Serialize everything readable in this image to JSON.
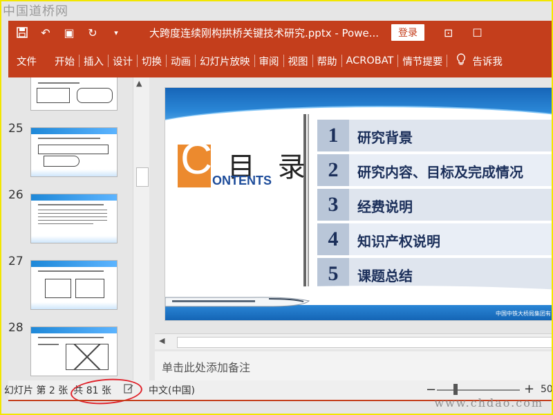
{
  "watermarks": {
    "top": "中国道桥网",
    "bottom": "www.chdao.com"
  },
  "titlebar": {
    "doc_title": "大跨度连续刚构拱桥关键技术研究.pptx - Powe...",
    "login_label": "登录",
    "icons": [
      "save-icon",
      "undo-icon",
      "present-from-start-icon",
      "redo-icon",
      "customize-qat-icon",
      "ribbon-display-icon",
      "maximize-icon"
    ]
  },
  "ribbon": {
    "tabs": [
      "文件",
      "开始",
      "插入",
      "设计",
      "切换",
      "动画",
      "幻灯片放映",
      "审阅",
      "视图",
      "帮助",
      "ACROBAT",
      "情节提要"
    ],
    "tell_me": "告诉我"
  },
  "thumbnails": {
    "numbers": [
      "25",
      "26",
      "27",
      "28"
    ]
  },
  "slide": {
    "c_letter": "C",
    "title_cn": "目 录",
    "title_en": "ONTENTS",
    "items": [
      {
        "num": "1",
        "text": "研究背景"
      },
      {
        "num": "2",
        "text": "研究内容、目标及完成情况"
      },
      {
        "num": "3",
        "text": "经费说明"
      },
      {
        "num": "4",
        "text": "知识产权说明"
      },
      {
        "num": "5",
        "text": "课题总结"
      }
    ],
    "logo": "中国中铁大桥局集团有"
  },
  "notes": {
    "placeholder": "单击此处添加备注"
  },
  "status": {
    "slide_indicator": "幻灯片 第 2 张",
    "total": "共 81 张",
    "language": "中文(中国)",
    "zoom": "50"
  }
}
